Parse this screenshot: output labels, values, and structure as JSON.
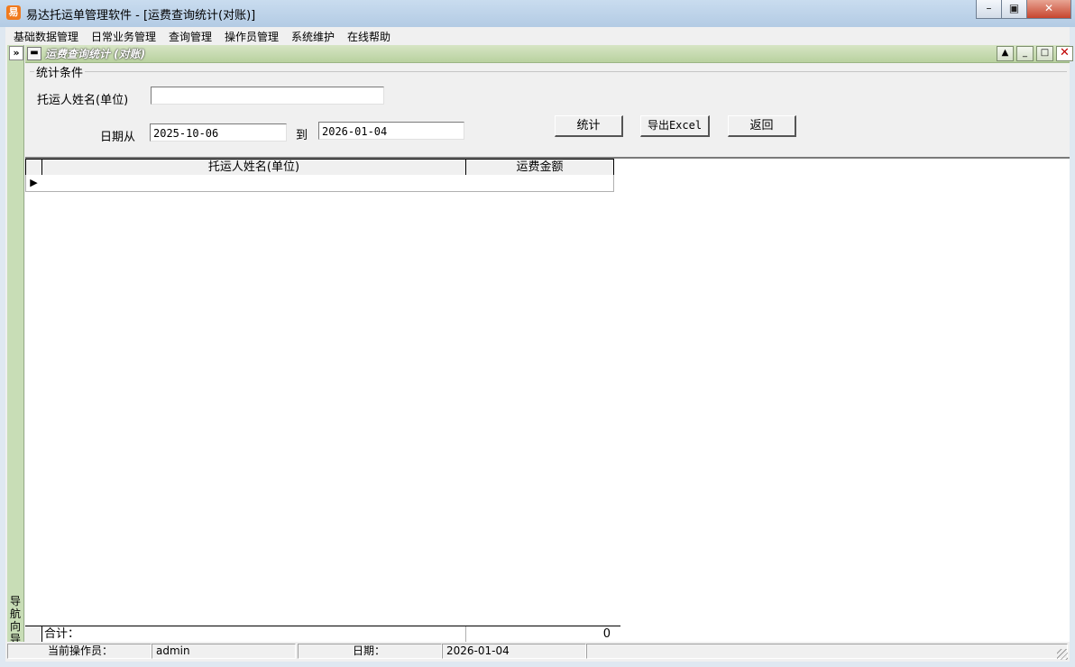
{
  "window": {
    "title": "易达托运单管理软件  - [运费查询统计(对账)]",
    "icon_glyph": "易"
  },
  "menubar": {
    "items": [
      "基础数据管理",
      "日常业务管理",
      "查询管理",
      "操作员管理",
      "系统维护",
      "在线帮助"
    ]
  },
  "nav_strip": {
    "chevron": "»",
    "label": "导航向导"
  },
  "child_window": {
    "title": "运费查询统计 (对账)"
  },
  "form": {
    "group_title": "统计条件",
    "shipper_label": "托运人姓名(单位)",
    "shipper_value": "",
    "date_from_label": "日期从",
    "date_from_value": "2025-10-06",
    "to_label": "到",
    "date_to_value": "2026-01-04",
    "stats_button": "统计",
    "export_button": "导出Excel",
    "back_button": "返回"
  },
  "grid": {
    "columns": [
      "托运人姓名(单位)",
      "运费金额"
    ],
    "rows": [
      [
        "",
        ""
      ]
    ],
    "total_label": "合计：",
    "total_value": "0"
  },
  "statusbar": {
    "operator_label": "当前操作员：",
    "operator_value": "admin",
    "date_label": "日期：",
    "date_value": "2026-01-04"
  }
}
